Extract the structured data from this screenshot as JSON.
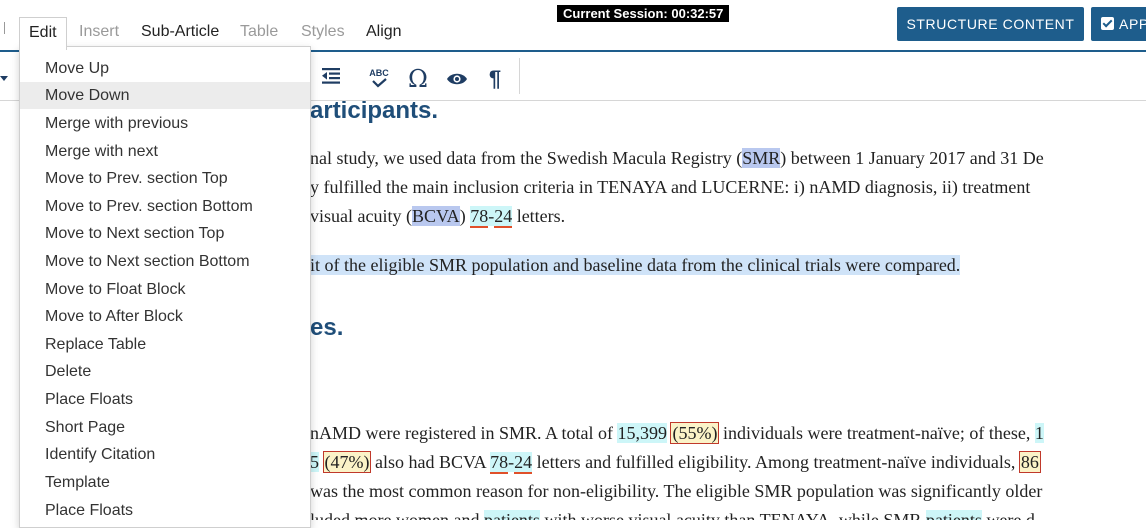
{
  "menubar": {
    "items": [
      {
        "label": "Edit",
        "state": "active"
      },
      {
        "label": "Insert",
        "state": "disabled"
      },
      {
        "label": "Sub-Article",
        "state": "enabled"
      },
      {
        "label": "Table",
        "state": "disabled"
      },
      {
        "label": "Styles",
        "state": "disabled"
      },
      {
        "label": "Align",
        "state": "enabled"
      }
    ],
    "session": "Current Session: 00:32:57",
    "structure_button": "STRUCTURE CONTENT",
    "approve_button": "APPROVE"
  },
  "toolbar": {
    "icons": [
      "outdent-icon",
      "spellcheck-icon",
      "omega-symbol-icon",
      "eye-icon",
      "pilcrow-icon"
    ],
    "spellcheck_glyph": "ABC",
    "omega_glyph": "Ω",
    "pilcrow_glyph": "¶"
  },
  "edit_menu": {
    "items": [
      "Move Up",
      "Move Down",
      "Merge with previous",
      "Merge with next",
      "Move to Prev. section Top",
      "Move to Prev. section Bottom",
      "Move to Next section Top",
      "Move to Next section Bottom",
      "Move to Float Block",
      "Move to After Block",
      "Replace Table",
      "Delete",
      "Place Floats",
      "Short Page",
      "Identify Citation",
      "Template",
      "Place Floats"
    ],
    "highlighted_index": 1
  },
  "document": {
    "heading1": "articipants.",
    "p1_l1_a": "nal study, we used data from the Swedish Macula Registry (",
    "p1_l1_abbr": "SMR",
    "p1_l1_b": ") between 1 January 2017 and 31 De",
    "p1_l2": "y fulfilled the main inclusion criteria in TENAYA and LUCERNE: i) nAMD diagnosis, ii) treatment",
    "p1_l3_a": " visual acuity (",
    "p1_l3_abbr": "BCVA",
    "p1_l3_b": ") ",
    "p1_l3_n1": "78",
    "p1_l3_dash": "-",
    "p1_l3_n2": "24",
    "p1_l3_c": " letters.",
    "p2": "it of the eligible SMR population and baseline data from the clinical trials were compared.",
    "heading2": "es.",
    "p3_l1_a": "nAMD were registered in SMR. A total of ",
    "p3_l1_num": "15,399",
    "p3_l1_pct": "(55%)",
    "p3_l1_b": " individuals were treatment-naïve; of these, ",
    "p3_l1_tail": "1",
    "p3_l2_head": "5",
    "p3_l2_pct": "(47%)",
    "p3_l2_a": " also had BCVA ",
    "p3_l2_n1": "78",
    "p3_l2_dash": "-",
    "p3_l2_n2": "24",
    "p3_l2_b": " letters and fulfilled eligibility. Among treatment-naïve individuals, ",
    "p3_l2_tail": "86",
    "p3_l3": "was the most common reason for non-eligibility. The eligible SMR population was significantly older",
    "p3_l4_a": "luded more women and ",
    "p3_l4_w1": "patients",
    "p3_l4_b": " with worse visual acuity than TENAYA, while SMR ",
    "p3_l4_w2": "patients",
    "p3_l4_c": " were d"
  }
}
